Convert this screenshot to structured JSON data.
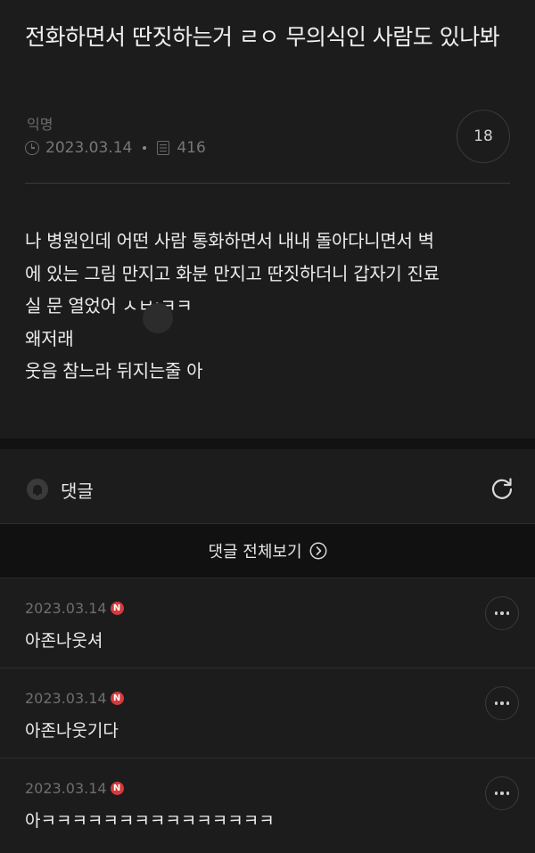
{
  "post": {
    "title": "전화하면서 딴짓하는거 ㄹㅇ 무의식인 사람도 있나봐",
    "author": "익명",
    "date": "2023.03.14",
    "views": "416",
    "comment_count": "18",
    "body_lines": [
      "나 병원인데 어떤 사람 통화하면서 내내 돌아다니면서 벽",
      "에 있는 그림 만지고 화분 만지고 딴짓하더니 갑자기 진료",
      "실 문 열었어 ㅅㅂ;ㅋㅋ",
      "왜저래",
      "웃음 참느라 뒤지는줄 아"
    ]
  },
  "comments_section": {
    "label": "댓글",
    "view_all_label": "댓글 전체보기",
    "badge_letter": "N",
    "items": [
      {
        "date": "2023.03.14",
        "text": "아존나웃셔"
      },
      {
        "date": "2023.03.14",
        "text": "아존나웃기다"
      },
      {
        "date": "2023.03.14",
        "text": "아ㅋㅋㅋㅋㅋㅋㅋㅋㅋㅋㅋㅋㅋㅋㅋ"
      }
    ]
  },
  "icons": {
    "clock": "clock-icon",
    "views": "document-icon",
    "bell": "bell-icon",
    "refresh": "refresh-icon",
    "chevron": "chevron-right-circle-icon",
    "more": "more-dots-icon"
  },
  "colors": {
    "background": "#1a1a1a",
    "badge": "#d63a3a",
    "text": "#ececec",
    "muted": "#6e6e6e"
  }
}
